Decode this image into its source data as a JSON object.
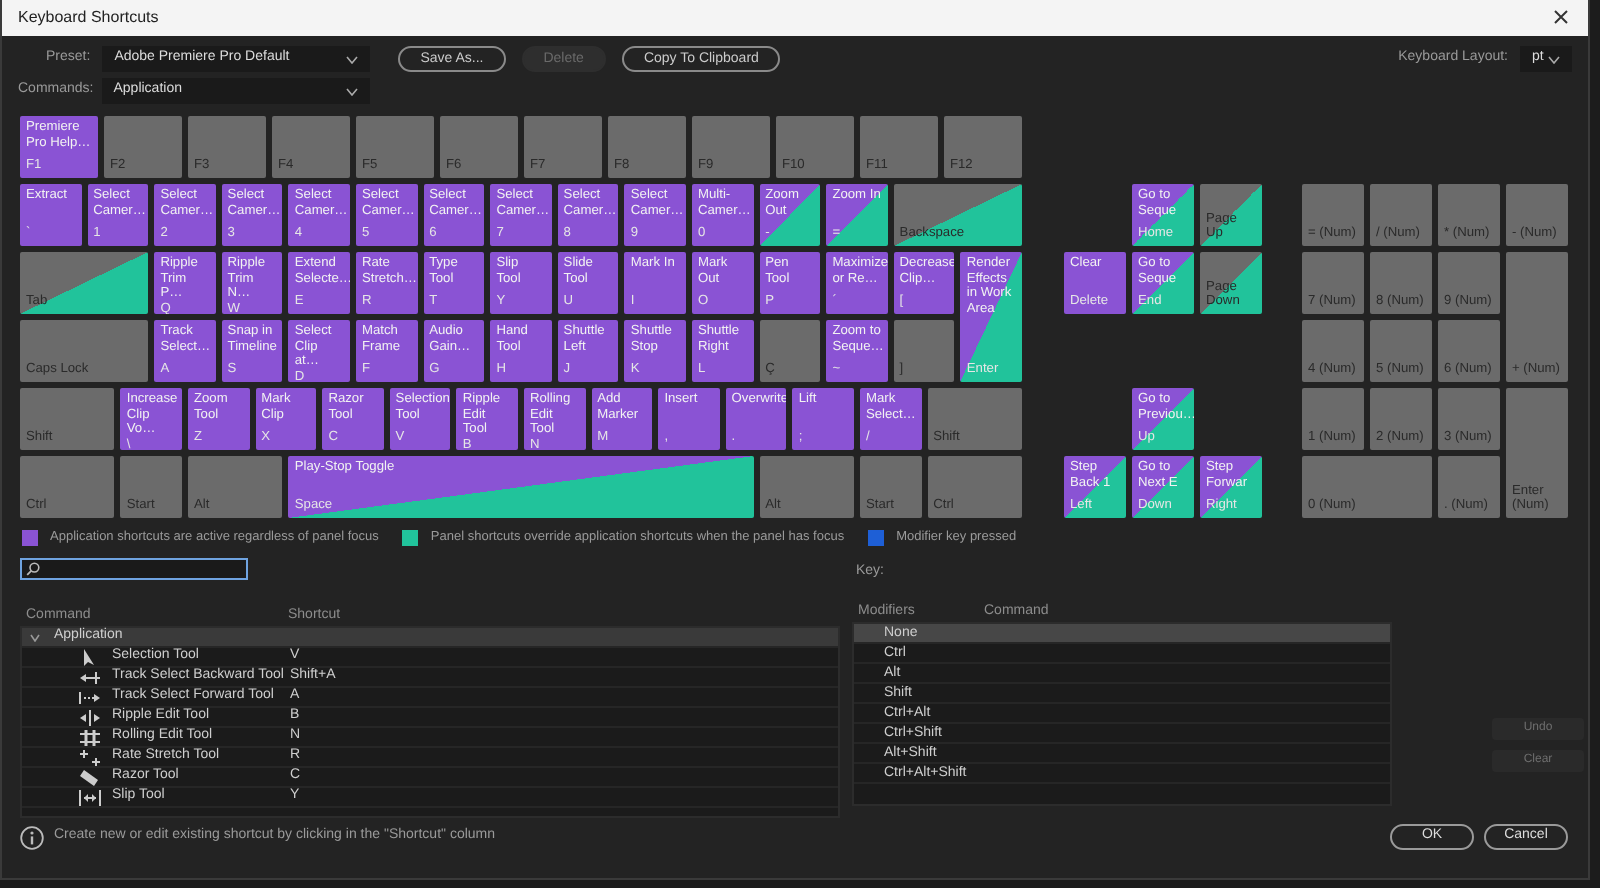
{
  "window": {
    "title": "Keyboard Shortcuts"
  },
  "preset": {
    "label": "Preset:",
    "value": "Adobe Premiere Pro Default"
  },
  "top_buttons": [
    {
      "label": "Save As...",
      "disabled": false
    },
    {
      "label": "Delete",
      "disabled": true
    },
    {
      "label": "Copy To Clipboard",
      "disabled": false
    }
  ],
  "keyboard_layout": {
    "label": "Keyboard Layout:",
    "value": "pt"
  },
  "commands": {
    "label": "Commands:",
    "value": "Application"
  },
  "keyboard": {
    "main_rows": [
      [
        {
          "command": "Premiere Pro Help…",
          "label": "F1",
          "application": true,
          "panel": false
        },
        {
          "label": "F2",
          "application": false,
          "panel": false
        },
        {
          "label": "F3",
          "application": false,
          "panel": false
        },
        {
          "label": "F4",
          "application": false,
          "panel": false
        },
        {
          "label": "F5",
          "application": false,
          "panel": false
        },
        {
          "label": "F6",
          "application": false,
          "panel": false
        },
        {
          "label": "F7",
          "application": false,
          "panel": false
        },
        {
          "label": "F8",
          "application": false,
          "panel": false
        },
        {
          "label": "F9",
          "application": false,
          "panel": false
        },
        {
          "label": "F10",
          "application": false,
          "panel": false
        },
        {
          "label": "F11",
          "application": false,
          "panel": false
        },
        {
          "label": "F12",
          "application": false,
          "panel": false
        }
      ],
      [
        {
          "command": "Extract",
          "label": "`",
          "application": true,
          "panel": false
        },
        {
          "command": "Select Camer…",
          "label": "1",
          "application": true,
          "panel": false
        },
        {
          "command": "Select Camer…",
          "label": "2",
          "application": true,
          "panel": false
        },
        {
          "command": "Select Camer…",
          "label": "3",
          "application": true,
          "panel": false
        },
        {
          "command": "Select Camer…",
          "label": "4",
          "application": true,
          "panel": false
        },
        {
          "command": "Select Camer…",
          "label": "5",
          "application": true,
          "panel": false
        },
        {
          "command": "Select Camer…",
          "label": "6",
          "application": true,
          "panel": false
        },
        {
          "command": "Select Camer…",
          "label": "7",
          "application": true,
          "panel": false
        },
        {
          "command": "Select Camer…",
          "label": "8",
          "application": true,
          "panel": false
        },
        {
          "command": "Select Camer…",
          "label": "9",
          "application": true,
          "panel": false
        },
        {
          "command": "Multi-Camer…",
          "label": "0",
          "application": true,
          "panel": false
        },
        {
          "command": "Zoom Out",
          "label": "-",
          "application": true,
          "panel": true
        },
        {
          "command": "Zoom In",
          "label": "=",
          "application": true,
          "panel": true
        },
        {
          "label": "Backspace",
          "application": false,
          "panel": true
        }
      ],
      [
        {
          "label": "Tab",
          "application": false,
          "panel": true
        },
        {
          "command": "Ripple Trim P…",
          "label": "Q",
          "application": true,
          "panel": false
        },
        {
          "command": "Ripple Trim N…",
          "label": "W",
          "application": true,
          "panel": false
        },
        {
          "command": "Extend Selecte…",
          "label": "E",
          "application": true,
          "panel": false
        },
        {
          "command": "Rate Stretch…",
          "label": "R",
          "application": true,
          "panel": false
        },
        {
          "command": "Type Tool",
          "label": "T",
          "application": true,
          "panel": false
        },
        {
          "command": "Slip Tool",
          "label": "Y",
          "application": true,
          "panel": false
        },
        {
          "command": "Slide Tool",
          "label": "U",
          "application": true,
          "panel": false
        },
        {
          "command": "Mark In",
          "label": "I",
          "application": true,
          "panel": false
        },
        {
          "command": "Mark Out",
          "label": "O",
          "application": true,
          "panel": false
        },
        {
          "command": "Pen Tool",
          "label": "P",
          "application": true,
          "panel": false
        },
        {
          "command": "Maximize or Re…",
          "label": "´",
          "application": true,
          "panel": false
        },
        {
          "command": "Decrease Clip…",
          "label": "[",
          "application": true,
          "panel": false
        },
        {
          "command": "Render Effects in Work Area",
          "label": "Enter",
          "application": true,
          "panel": true
        }
      ],
      [
        {
          "label": "Caps Lock",
          "application": false,
          "panel": false
        },
        {
          "command": "Track Select…",
          "label": "A",
          "application": true,
          "panel": false
        },
        {
          "command": "Snap in Timeline",
          "label": "S",
          "application": true,
          "panel": false
        },
        {
          "command": "Select Clip at…",
          "label": "D",
          "application": true,
          "panel": false
        },
        {
          "command": "Match Frame",
          "label": "F",
          "application": true,
          "panel": false
        },
        {
          "command": "Audio Gain…",
          "label": "G",
          "application": true,
          "panel": false
        },
        {
          "command": "Hand Tool",
          "label": "H",
          "application": true,
          "panel": false
        },
        {
          "command": "Shuttle Left",
          "label": "J",
          "application": true,
          "panel": false
        },
        {
          "command": "Shuttle Stop",
          "label": "K",
          "application": true,
          "panel": false
        },
        {
          "command": "Shuttle Right",
          "label": "L",
          "application": true,
          "panel": false
        },
        {
          "label": "Ç",
          "application": false,
          "panel": false
        },
        {
          "command": "Zoom to Seque…",
          "label": "~",
          "application": true,
          "panel": false
        },
        {
          "label": "]",
          "application": false,
          "panel": false
        }
      ],
      [
        {
          "label": "Shift",
          "application": false,
          "panel": false
        },
        {
          "command": "Increase Clip Vo…",
          "label": "\\",
          "application": true,
          "panel": false
        },
        {
          "command": "Zoom Tool",
          "label": "Z",
          "application": true,
          "panel": false
        },
        {
          "command": "Mark Clip",
          "label": "X",
          "application": true,
          "panel": false
        },
        {
          "command": "Razor Tool",
          "label": "C",
          "application": true,
          "panel": false
        },
        {
          "command": "Selection Tool",
          "label": "V",
          "application": true,
          "panel": false
        },
        {
          "command": "Ripple Edit Tool",
          "label": "B",
          "application": true,
          "panel": false
        },
        {
          "command": "Rolling Edit Tool",
          "label": "N",
          "application": true,
          "panel": false
        },
        {
          "command": "Add Marker",
          "label": "M",
          "application": true,
          "panel": false
        },
        {
          "command": "Insert",
          "label": ",",
          "application": true,
          "panel": false
        },
        {
          "command": "Overwrite",
          "label": ".",
          "application": true,
          "panel": false
        },
        {
          "command": "Lift",
          "label": ";",
          "application": true,
          "panel": false
        },
        {
          "command": "Mark Select…",
          "label": "/",
          "application": true,
          "panel": false
        },
        {
          "label": "Shift",
          "application": false,
          "panel": false
        }
      ],
      [
        {
          "label": "Ctrl",
          "application": false,
          "panel": false
        },
        {
          "label": "Start",
          "application": false,
          "panel": false
        },
        {
          "label": "Alt",
          "application": false,
          "panel": false
        },
        {
          "command": "Play-Stop Toggle",
          "label": "Space",
          "application": true,
          "panel": true
        },
        {
          "label": "Alt",
          "application": false,
          "panel": false
        },
        {
          "label": "Start",
          "application": false,
          "panel": false
        },
        {
          "label": "Ctrl",
          "application": false,
          "panel": false
        }
      ]
    ],
    "navigation": [
      {
        "command": "Go to Seque",
        "label": "Home",
        "application": true,
        "panel": true
      },
      {
        "label": "Page Up",
        "application": false,
        "panel": true
      },
      {
        "command": "Clear",
        "label": "Delete",
        "application": true,
        "panel": false
      },
      {
        "command": "Go to Seque",
        "label": "End",
        "application": true,
        "panel": true
      },
      {
        "label": "Page Down",
        "application": false,
        "panel": true
      },
      {
        "command": "Go to Previou…",
        "label": "Up",
        "application": true,
        "panel": true
      },
      {
        "command": "Step Back 1",
        "label": "Left",
        "application": true,
        "panel": true
      },
      {
        "command": "Go to Next E",
        "label": "Down",
        "application": true,
        "panel": true
      },
      {
        "command": "Step Forwar",
        "label": "Right",
        "application": true,
        "panel": true
      }
    ],
    "numpad": [
      {
        "label": "= (Num)",
        "application": false,
        "panel": false
      },
      {
        "label": "/ (Num)",
        "application": false,
        "panel": false
      },
      {
        "label": "* (Num)",
        "application": false,
        "panel": false
      },
      {
        "label": "- (Num)",
        "application": false,
        "panel": false
      },
      {
        "label": "7 (Num)",
        "application": false,
        "panel": false
      },
      {
        "label": "8 (Num)",
        "application": false,
        "panel": false
      },
      {
        "label": "9 (Num)",
        "application": false,
        "panel": false
      },
      {
        "label": "4 (Num)",
        "application": false,
        "panel": false
      },
      {
        "label": "5 (Num)",
        "application": false,
        "panel": false
      },
      {
        "label": "6 (Num)",
        "application": false,
        "panel": false
      },
      {
        "label": "+ (Num)",
        "application": false,
        "panel": false
      },
      {
        "label": "1 (Num)",
        "application": false,
        "panel": false
      },
      {
        "label": "2 (Num)",
        "application": false,
        "panel": false
      },
      {
        "label": "3 (Num)",
        "application": false,
        "panel": false
      },
      {
        "label": "0 (Num)",
        "application": false,
        "panel": false
      },
      {
        "label": ". (Num)",
        "application": false,
        "panel": false
      },
      {
        "label": "Enter (Num)",
        "application": false,
        "panel": false
      }
    ]
  },
  "legend": [
    {
      "text": "Application shortcuts are active regardless of panel focus",
      "color": "#8a53d4"
    },
    {
      "text": "Panel shortcuts override application shortcuts when the panel has focus",
      "color": "#21c39b"
    },
    {
      "text": "Modifier key pressed",
      "color": "#1e5fd6"
    }
  ],
  "command_table": {
    "columns": [
      "Command",
      "Shortcut"
    ],
    "group": {
      "label": "Application",
      "expanded": true
    },
    "rows": [
      {
        "command": "Selection Tool",
        "shortcut": "V"
      },
      {
        "command": "Track Select Backward Tool",
        "shortcut": "Shift+A"
      },
      {
        "command": "Track Select Forward Tool",
        "shortcut": "A"
      },
      {
        "command": "Ripple Edit Tool",
        "shortcut": "B"
      },
      {
        "command": "Rolling Edit Tool",
        "shortcut": "N"
      },
      {
        "command": "Rate Stretch Tool",
        "shortcut": "R"
      },
      {
        "command": "Razor Tool",
        "shortcut": "C"
      },
      {
        "command": "Slip Tool",
        "shortcut": "Y"
      }
    ]
  },
  "key_panel": {
    "label": "Key:",
    "columns": [
      "Modifiers",
      "Command"
    ],
    "rows": [
      {
        "modifiers": "None",
        "selected": true
      },
      {
        "modifiers": "Ctrl",
        "selected": false
      },
      {
        "modifiers": "Alt",
        "selected": false
      },
      {
        "modifiers": "Shift",
        "selected": false
      },
      {
        "modifiers": "Ctrl+Alt",
        "selected": false
      },
      {
        "modifiers": "Ctrl+Shift",
        "selected": false
      },
      {
        "modifiers": "Alt+Shift",
        "selected": false
      },
      {
        "modifiers": "Ctrl+Alt+Shift",
        "selected": false
      }
    ]
  },
  "side_buttons": [
    {
      "label": "Undo",
      "disabled": true
    },
    {
      "label": "Clear",
      "disabled": true
    }
  ],
  "info": "Create new or edit existing shortcut by clicking in the \"Shortcut\" column",
  "dialog_buttons": [
    {
      "label": "OK"
    },
    {
      "label": "Cancel"
    }
  ]
}
